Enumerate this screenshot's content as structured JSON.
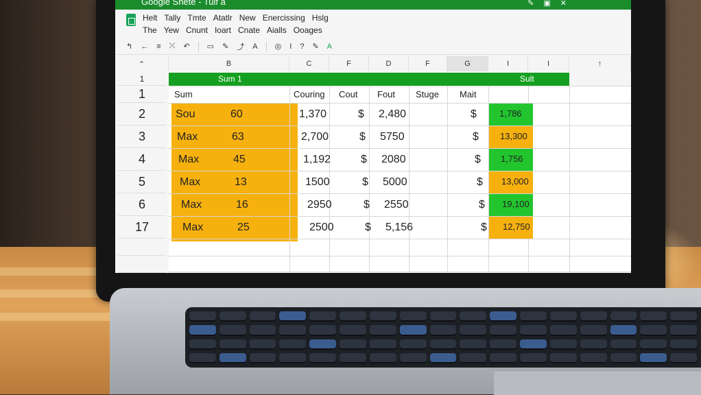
{
  "app_title": "Google Shete - Tulf a",
  "menu_row1": [
    "Helt",
    "Tally",
    "Tmte",
    "Atatlr",
    "New",
    "Enercissing",
    "Hslg"
  ],
  "menu_row2": [
    "The",
    "Yew",
    "Cnunt",
    "Ioart",
    "Cnate",
    "Aialls",
    "Ooages"
  ],
  "toolbar_glyphs": [
    "↰",
    "←",
    "≡",
    "⤫",
    "↶",
    "▭",
    "✎",
    "⤴",
    "A",
    "◎",
    "I",
    "?",
    "✎",
    "A"
  ],
  "columns": [
    "B",
    "C",
    "F",
    "D",
    "F",
    "G",
    "I",
    "I"
  ],
  "band": {
    "left": "Sum 1",
    "right": "Sult"
  },
  "header_row": {
    "row_num": "1",
    "sum": "Sum",
    "c": "Couring",
    "f": "Cout",
    "d": "Fout",
    "f2": "Stuge",
    "g": "Mait"
  },
  "rows": [
    {
      "num": "2",
      "label": "Sou",
      "val": "60",
      "c": "1,370",
      "d": "2,480",
      "g": "1,786"
    },
    {
      "num": "3",
      "label": "Max",
      "val": "63",
      "c": "2,700",
      "d": "5750",
      "g": "13,300"
    },
    {
      "num": "4",
      "label": "Max",
      "val": "45",
      "c": "1,192",
      "d": "2080",
      "g": "1,756"
    },
    {
      "num": "5",
      "label": "Max",
      "val": "13",
      "c": "1500",
      "d": "5000",
      "g": "13,000"
    },
    {
      "num": "6",
      "label": "Max",
      "val": "16",
      "c": "2950",
      "d": "2550",
      "g": "19,100"
    },
    {
      "num": "17",
      "label": "Max",
      "val": "25",
      "c": "2500",
      "d": "5,156",
      "g": "12,750"
    }
  ],
  "currency": "$",
  "g_colors": [
    "#22c52e",
    "#f6b10f",
    "#22c52e",
    "#f6b10f",
    "#22c52e",
    "#f6b10f"
  ]
}
